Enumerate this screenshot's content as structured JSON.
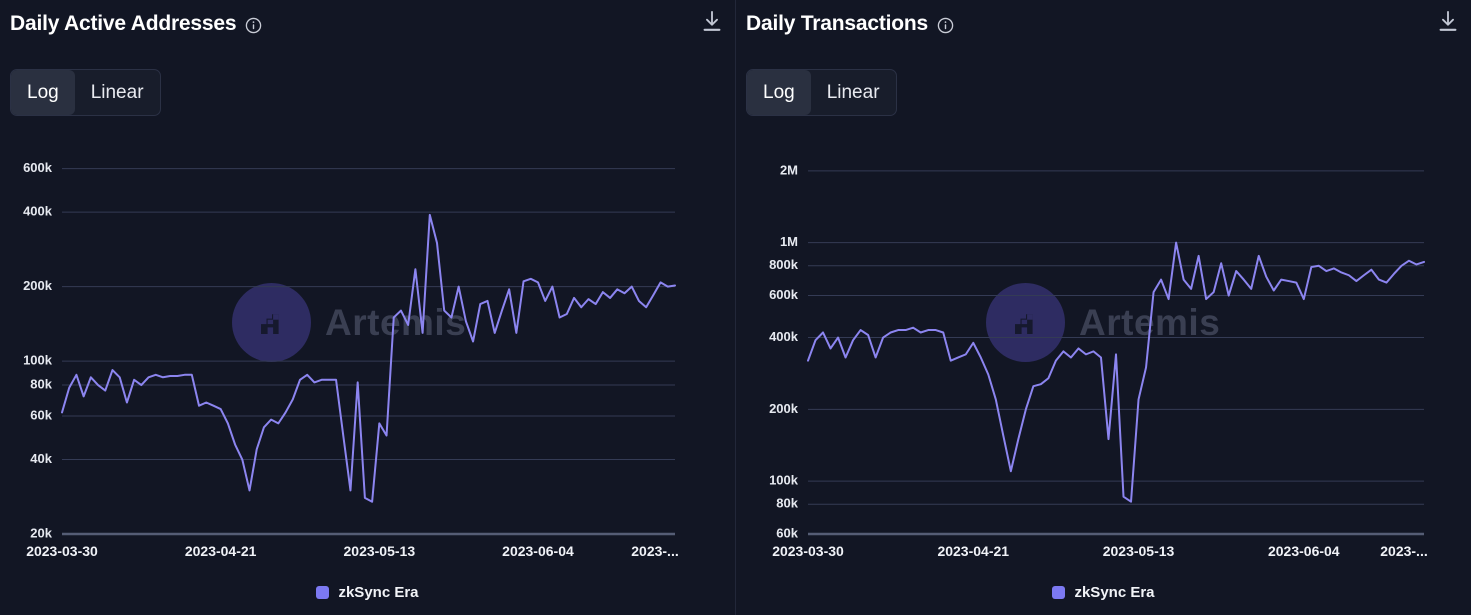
{
  "theme": {
    "background": "#121624",
    "line_color": "#8c85f0",
    "legend_swatch": "#7c79f2",
    "grid_color": "#343b55",
    "text_color": "#ffffff",
    "toggle_active_bg": "#2a3040"
  },
  "panels": [
    {
      "id": "daily-active-addresses",
      "title": "Daily Active Addresses",
      "info_icon": "info-circle-icon",
      "download_icon": "download-icon",
      "scale_toggle": {
        "options": [
          "Log",
          "Linear"
        ],
        "selected": "Log"
      },
      "legend": [
        {
          "label": "zkSync Era",
          "color": "#7c79f2"
        }
      ],
      "watermark": {
        "text": "Artemis",
        "logo": "artemis-logo-icon"
      },
      "chart_data": {
        "type": "line",
        "title": "Daily Active Addresses",
        "xlabel": "",
        "ylabel": "",
        "yscale": "log",
        "grid": true,
        "legend_position": "bottom",
        "ylim": [
          20000,
          700000
        ],
        "yticks": [
          20000,
          40000,
          60000,
          80000,
          100000,
          200000,
          400000,
          600000
        ],
        "ytick_labels": [
          "20k",
          "40k",
          "60k",
          "80k",
          "100k",
          "200k",
          "400k",
          "600k"
        ],
        "xtick_labels": [
          "2023-03-30",
          "2023-04-21",
          "2023-05-13",
          "2023-06-04",
          "2023-..."
        ],
        "x_start": "2023-03-30",
        "x_end": "2023-06-26",
        "series": [
          {
            "name": "zkSync Era",
            "color": "#8c85f0",
            "values": [
              62000,
              78000,
              88000,
              72000,
              86000,
              80000,
              76000,
              92000,
              86000,
              68000,
              84000,
              80000,
              86000,
              88000,
              86000,
              87000,
              87000,
              88000,
              88000,
              66000,
              68000,
              66000,
              64000,
              56000,
              46000,
              40000,
              30000,
              44000,
              54000,
              58000,
              56000,
              62000,
              70000,
              84000,
              88000,
              82000,
              84000,
              84000,
              84000,
              50000,
              30000,
              82000,
              28000,
              27000,
              56000,
              50000,
              150000,
              160000,
              140000,
              235000,
              130000,
              390000,
              300000,
              160000,
              150000,
              200000,
              145000,
              120000,
              170000,
              175000,
              130000,
              160000,
              195000,
              130000,
              210000,
              215000,
              208000,
              175000,
              200000,
              150000,
              155000,
              180000,
              165000,
              178000,
              170000,
              190000,
              180000,
              195000,
              188000,
              200000,
              175000,
              165000,
              185000,
              208000,
              200000,
              202000
            ]
          }
        ]
      }
    },
    {
      "id": "daily-transactions",
      "title": "Daily Transactions",
      "info_icon": "info-circle-icon",
      "download_icon": "download-icon",
      "scale_toggle": {
        "options": [
          "Log",
          "Linear"
        ],
        "selected": "Log"
      },
      "legend": [
        {
          "label": "zkSync Era",
          "color": "#7c79f2"
        }
      ],
      "watermark": {
        "text": "Artemis",
        "logo": "artemis-logo-icon"
      },
      "chart_data": {
        "type": "line",
        "title": "Daily Transactions",
        "xlabel": "",
        "ylabel": "",
        "yscale": "log",
        "grid": true,
        "legend_position": "bottom",
        "ylim": [
          60000,
          2400000
        ],
        "yticks": [
          60000,
          80000,
          100000,
          200000,
          400000,
          600000,
          800000,
          1000000,
          2000000
        ],
        "ytick_labels": [
          "60k",
          "80k",
          "100k",
          "200k",
          "400k",
          "600k",
          "800k",
          "1M",
          "2M"
        ],
        "xtick_labels": [
          "2023-03-30",
          "2023-04-21",
          "2023-05-13",
          "2023-06-04",
          "2023-..."
        ],
        "x_start": "2023-03-30",
        "x_end": "2023-06-26",
        "series": [
          {
            "name": "zkSync Era",
            "color": "#8c85f0",
            "values": [
              320000,
              390000,
              420000,
              360000,
              400000,
              330000,
              390000,
              430000,
              410000,
              330000,
              400000,
              420000,
              430000,
              430000,
              440000,
              420000,
              430000,
              430000,
              420000,
              320000,
              330000,
              340000,
              380000,
              330000,
              280000,
              220000,
              155000,
              110000,
              150000,
              200000,
              250000,
              255000,
              270000,
              320000,
              350000,
              330000,
              360000,
              340000,
              350000,
              330000,
              150000,
              340000,
              86000,
              82000,
              220000,
              300000,
              620000,
              700000,
              580000,
              1000000,
              700000,
              640000,
              880000,
              580000,
              620000,
              820000,
              600000,
              760000,
              700000,
              640000,
              880000,
              720000,
              630000,
              700000,
              690000,
              680000,
              580000,
              790000,
              800000,
              760000,
              780000,
              750000,
              730000,
              690000,
              730000,
              770000,
              700000,
              680000,
              740000,
              800000,
              840000,
              810000,
              830000
            ]
          }
        ]
      }
    }
  ]
}
